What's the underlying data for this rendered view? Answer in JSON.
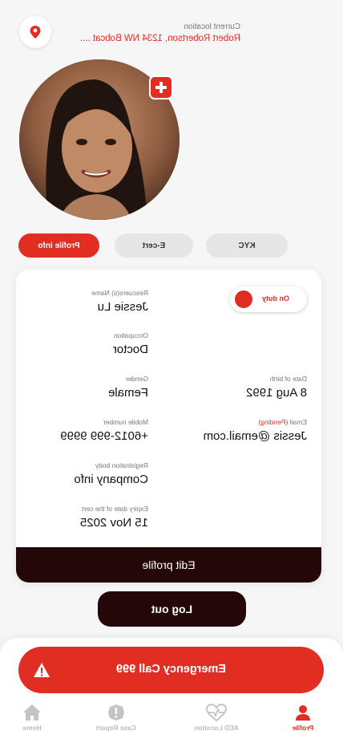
{
  "header": {
    "location_caption": "Current location",
    "location_value": "Robert Robertson, 1234 NW Bobcat ...."
  },
  "tabs": [
    {
      "label": "Profile info",
      "active": true
    },
    {
      "label": "E-cert",
      "active": false
    },
    {
      "label": "KYC",
      "active": false
    }
  ],
  "profile": {
    "duty_status": "On duty",
    "name_caption": "Rescuers(s) Name",
    "name": "Jessie Lu",
    "occupation_caption": "Occupation",
    "occupation": "Doctor",
    "gender_caption": "Gender",
    "gender": "Female",
    "dob_caption": "Date of birth",
    "dob": "8 Aug 1992",
    "mobile_caption": "Mobile number",
    "mobile": "+6012-999 9999",
    "email_caption": "Email",
    "email_status": "(Pending)",
    "email": "Jessis @email.com",
    "reg_body_caption": "Registration body",
    "reg_body": "Company info",
    "expiry_caption": "Expiry date of the cert",
    "expiry": "15 Nov 2025"
  },
  "actions": {
    "edit_profile": "Edit profile",
    "log_out": "Log out",
    "emergency_call": "Emergency Call 999"
  },
  "nav": [
    {
      "label": "Home",
      "icon": "home-icon",
      "active": false
    },
    {
      "label": "Case Report",
      "icon": "alert-circle-icon",
      "active": false
    },
    {
      "label": "AED Location",
      "icon": "heart-pulse-icon",
      "active": false
    },
    {
      "label": "Profile",
      "icon": "user-icon",
      "active": true
    }
  ],
  "colors": {
    "accent": "#e12d22",
    "dark": "#240708",
    "background": "#f6f6f6"
  }
}
